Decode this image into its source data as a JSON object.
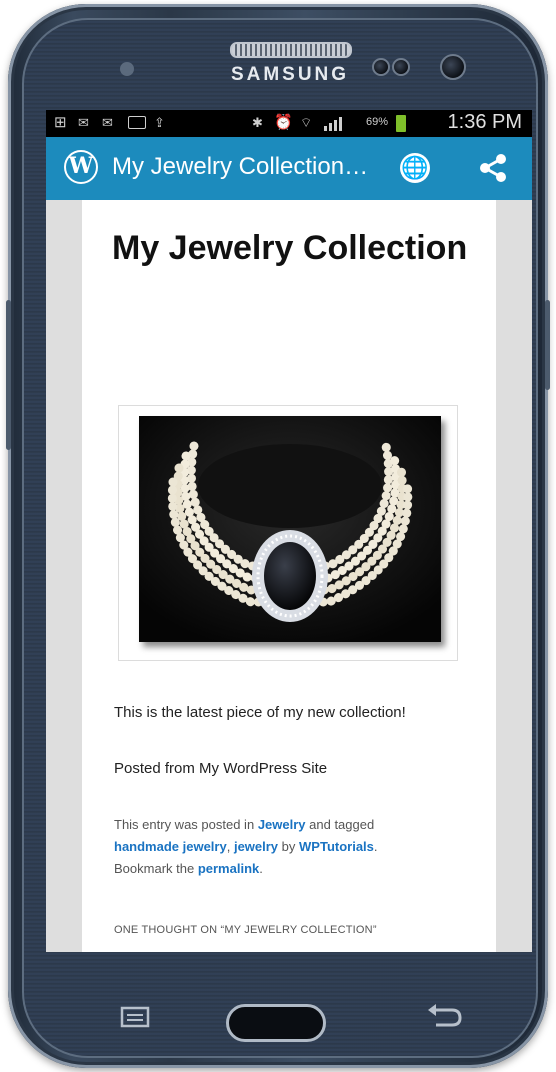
{
  "device": {
    "brand": "SAMSUNG"
  },
  "status_bar": {
    "battery_percent": "69%",
    "time": "1:36 PM"
  },
  "app_bar": {
    "title": "My Jewelry Collection…",
    "logo_letter": "W",
    "icons": [
      "wordpress-logo-icon",
      "globe-icon",
      "share-icon"
    ]
  },
  "post": {
    "title": "My Jewelry Collection",
    "image": "necklace-photo",
    "paragraph_1": "This is the latest piece of my new collection!",
    "paragraph_2": "Posted from My WordPress Site",
    "meta": {
      "prefix": "This entry was posted in",
      "category": "Jewelry",
      "tagged_text": "and tagged",
      "tag_1": "handmade jewelry",
      "tag_2": "jewelry",
      "by_text": "by",
      "author": "WPTutorials",
      "bookmark_text": "Bookmark the",
      "permalink": "permalink"
    },
    "comments_heading": "ONE THOUGHT ON “MY JEWELRY COLLECTION”"
  },
  "colors": {
    "app_bar": "#1c8bbd",
    "link": "#1a73c2",
    "battery": "#7fbf2a"
  }
}
